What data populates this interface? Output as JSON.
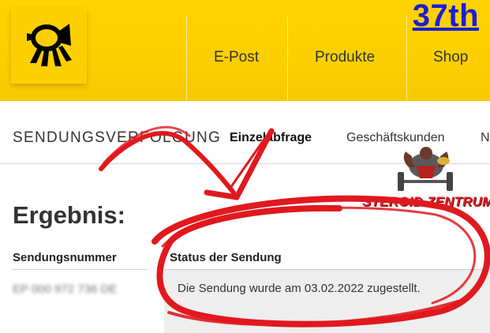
{
  "brand": {
    "accent_color": "#fcd000",
    "logo_icon": "posthorn-icon"
  },
  "corner_label": "37th",
  "nav": {
    "items": [
      {
        "label": "E-Post"
      },
      {
        "label": "Produkte"
      },
      {
        "label": "Shop"
      }
    ]
  },
  "subnav": {
    "title": "SENDUNGSVERFOLGUNG",
    "items": [
      {
        "label": "Einzelabfrage",
        "active": true
      },
      {
        "label": "Geschäftskunden",
        "active": false
      },
      {
        "label": "N",
        "active": false
      }
    ]
  },
  "result": {
    "heading": "Ergebnis:",
    "columns": {
      "number": "Sendungsnummer",
      "status": "Status der Sendung"
    },
    "tracking_number": "EP 000 972 736 DE",
    "status_text": "Die Sendung wurde am 03.02.2022 zugestellt."
  },
  "watermark": {
    "text": "STEROID ZENTRUM",
    "icon": "bodybuilder-icon"
  },
  "annotation": {
    "color": "#e0191f",
    "icon": "red-arrow-circle-icon"
  }
}
